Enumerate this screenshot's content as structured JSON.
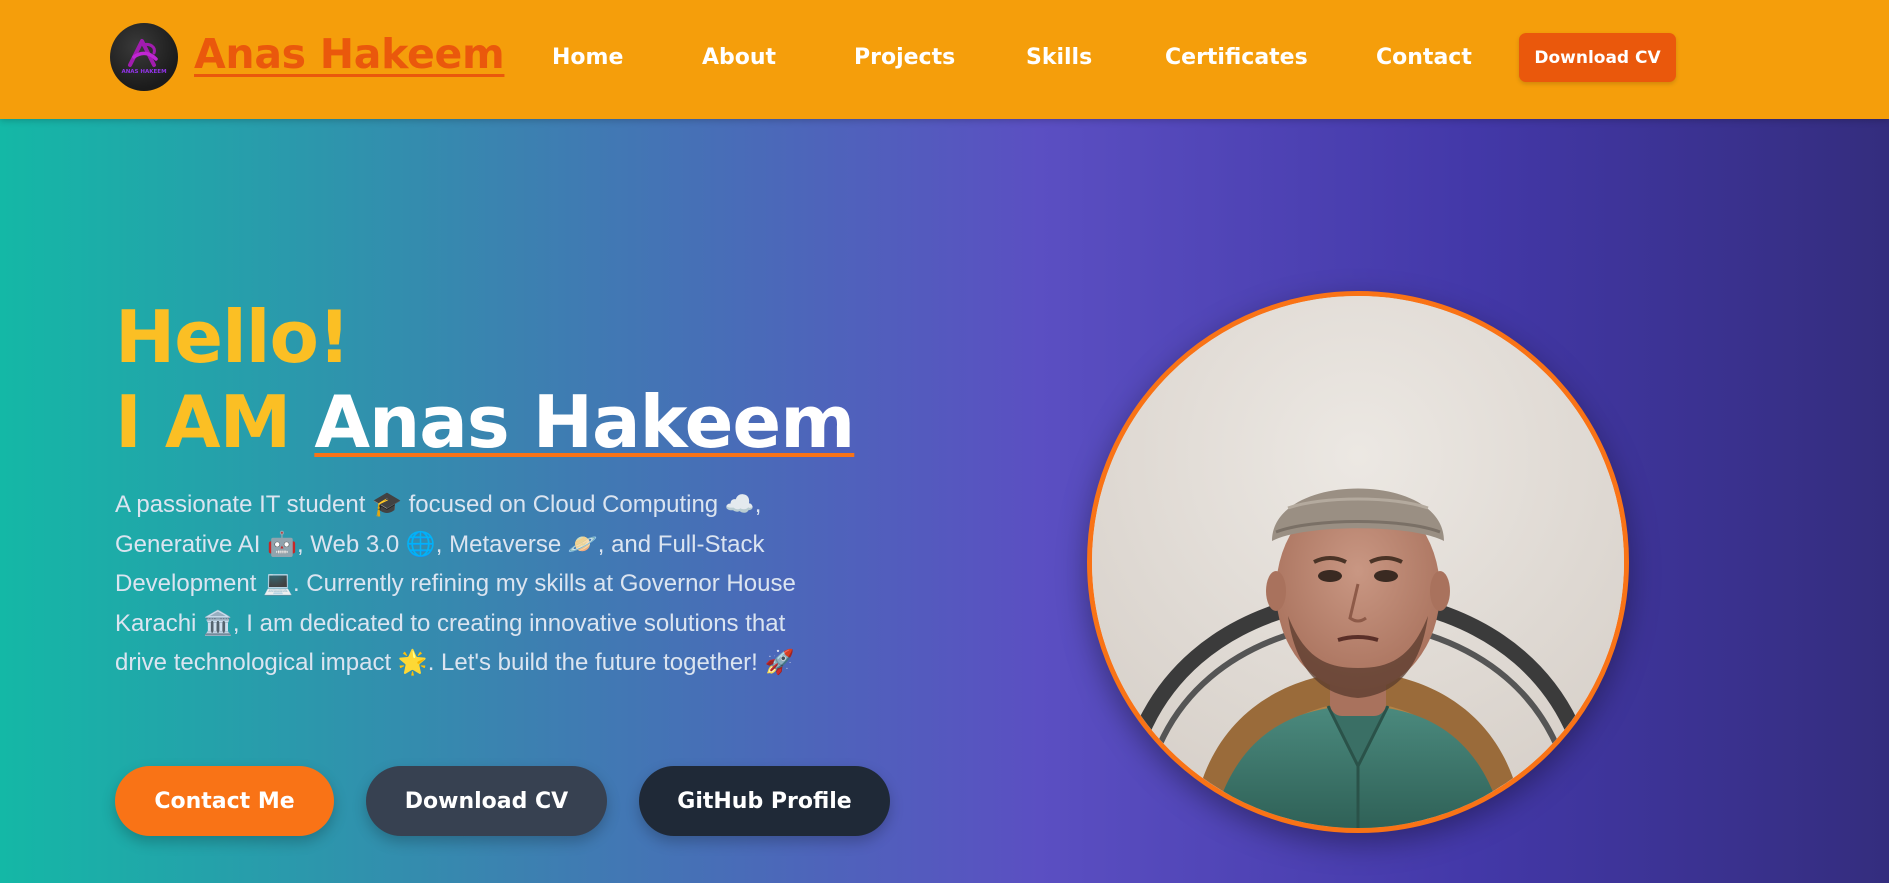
{
  "header": {
    "logo_text": "ANAS HAKEEM",
    "brand": "Anas Hakeem",
    "nav": [
      "Home",
      "About",
      "Projects",
      "Skills",
      "Certificates",
      "Contact"
    ],
    "cv_button": "Download CV"
  },
  "hero": {
    "greeting": "Hello!",
    "iam": "I AM",
    "name": "Anas Hakeem",
    "description": "A passionate IT student 🎓 focused on Cloud Computing ☁️, Generative AI 🤖, Web 3.0 🌐, Metaverse 🪐, and Full-Stack Development 💻. Currently refining my skills at Governor House Karachi 🏛️, I am dedicated to creating innovative solutions that drive technological impact 🌟. Let's build the future together! 🚀",
    "buttons": {
      "contact": "Contact Me",
      "cv": "Download CV",
      "github": "GitHub Profile"
    }
  },
  "colors": {
    "navbar": "#f59e0b",
    "accent_orange": "#f97316",
    "brand_orange": "#ea580c",
    "heading_yellow": "#fbbf24"
  }
}
